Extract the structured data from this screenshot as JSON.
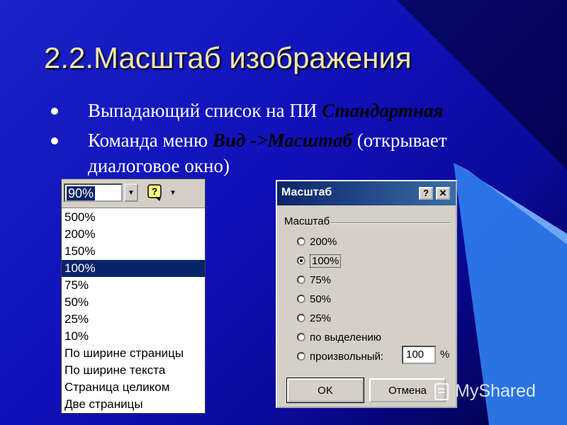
{
  "slide": {
    "title": "2.2.Масштаб изображения",
    "bullets": [
      {
        "text": "Выпадающий список на ПИ ",
        "emphasis": "Стандартная",
        "after": ""
      },
      {
        "text": "Команда меню ",
        "emphasis": "Вид ->Масштаб",
        "after": " (открывает диалоговое окно)"
      }
    ]
  },
  "zoom_combo": {
    "value": "90%",
    "items": [
      "500%",
      "200%",
      "150%",
      "100%",
      "75%",
      "50%",
      "25%",
      "10%",
      "По ширине страницы",
      "По ширине текста",
      "Страница целиком",
      "Две страницы"
    ],
    "selected": "100%"
  },
  "zoom_dialog": {
    "title": "Масштаб",
    "help_button": "?",
    "close_button": "✕",
    "group_label": "Масштаб",
    "options": [
      "200%",
      "100%",
      "75%",
      "50%",
      "25%",
      "по выделению",
      "произвольный:"
    ],
    "selected_option": "100%",
    "custom_value": "100",
    "percent_sign": "%",
    "ok_label": "OK",
    "cancel_label": "Отмена"
  },
  "watermark": "MyShared",
  "colors": {
    "background": "#1414c0",
    "title": "#f2e6b0",
    "selection": "#0a246a",
    "dialog_bg": "#d4d0c8"
  }
}
